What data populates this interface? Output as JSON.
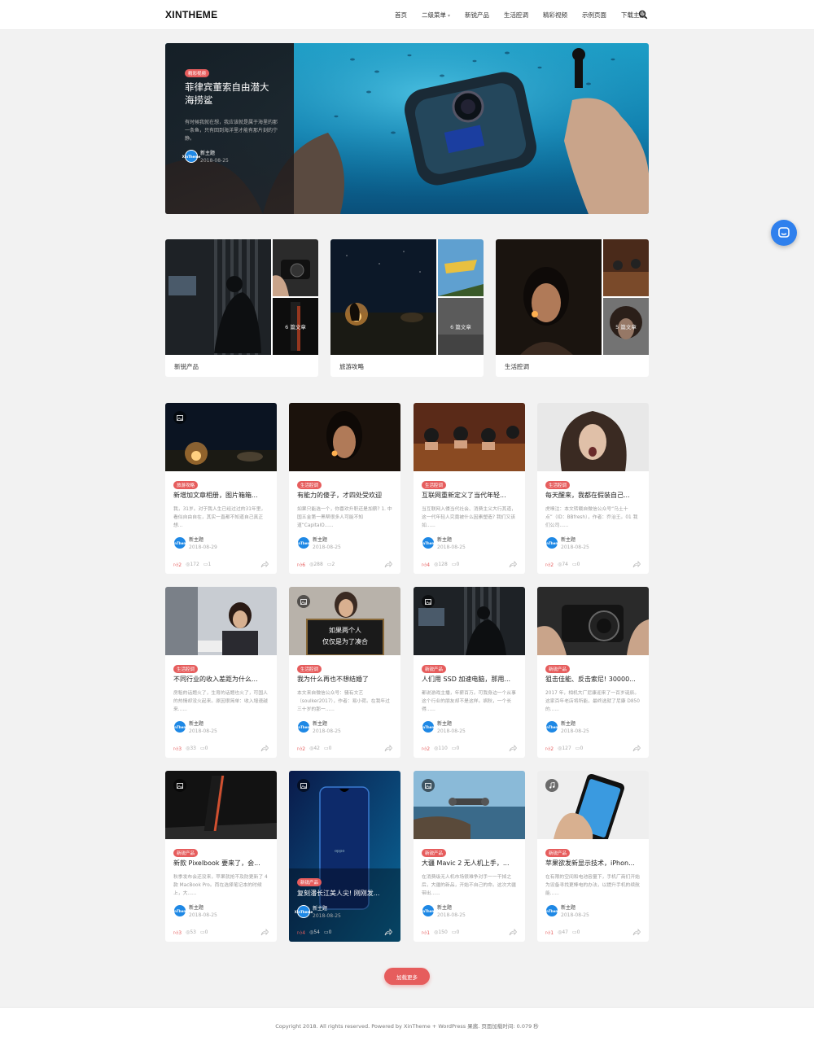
{
  "header": {
    "logo": "XINTHEME",
    "nav": [
      "首页",
      "二级菜单",
      "新锐产品",
      "生活腔调",
      "精彩视频",
      "示例页面",
      "下载主题"
    ]
  },
  "hero": {
    "tag": "精彩视频",
    "title": "菲律宾董索自由潜大海捞鲨",
    "desc": "有时候我就在想，我应该就是属于海里的那一条鱼，只有回到海洋里才能有那片刻的宁静。",
    "author": "新主题",
    "date": "2018-08-25"
  },
  "categories": [
    {
      "label": "新锐产品",
      "count": "6 篇文章"
    },
    {
      "label": "旅游攻略",
      "count": "6 篇文章"
    },
    {
      "label": "生活腔调",
      "count": "5 篇文章"
    }
  ],
  "cards": [
    {
      "tag": "旅游攻略",
      "title": "新增加文章相册，图片箱箱...",
      "excerpt": "我，31岁。对于我人生已经过过的31年里，看似自由自在，其实一直都不知道自己真正想...",
      "author": "新主题",
      "date": "2018-08-29",
      "likes": "2",
      "views": "172",
      "comments": "1"
    },
    {
      "tag": "生活腔调",
      "title": "有能力的傻子，才四处受欢迎",
      "excerpt": "如果只能选一个，你喜欢升职还是加薪? 1. 中国五金第一黑帮很多人可能不知道“CapitalO......",
      "author": "新主题",
      "date": "2018-08-25",
      "likes": "6",
      "views": "288",
      "comments": "2"
    },
    {
      "tag": "生活腔调",
      "title": "互联网重新定义了当代年轻...",
      "excerpt": "当互联网入侵当代社会、消费主义大行其道，这一代年轻人究竟被什么因素塑造? 我们又该如......",
      "author": "新主题",
      "date": "2018-08-25",
      "likes": "4",
      "views": "128",
      "comments": "0"
    },
    {
      "tag": "生活腔调",
      "title": "每天醒来，我都在假装自己...",
      "excerpt": "虎嗅注：本文转载自微信公众号“乌土十点”（ID：BBfresh），作者：乔治王。01 我们公司......",
      "author": "新主题",
      "date": "2018-08-25",
      "likes": "2",
      "views": "74",
      "comments": "0"
    },
    {
      "tag": "生活腔调",
      "title": "不同行业的收入差距为什么...",
      "excerpt": "房租的话题火了，生育的话题也火了，可国人的热情却没火起来。原因很简单：收入增速越来......",
      "author": "新主题",
      "date": "2018-08-25",
      "likes": "3",
      "views": "33",
      "comments": "0"
    },
    {
      "tag": "生活腔调",
      "title": "我为什么再也不想结婚了",
      "excerpt": "本文来自微信公众号：骚有文艺（soulker2017），作者：易小荷。在我年过三十岁的那一......",
      "author": "新主题",
      "date": "2018-08-25",
      "likes": "2",
      "views": "42",
      "comments": "0"
    },
    {
      "tag": "新锐产品",
      "title": "人们用 SSD 加速电脑，那用...",
      "excerpt": "都说游戏主播，年薪百万。可我身边一个从事这个行业的朋友却不是这样。飒秋，一个长得......",
      "author": "新主题",
      "date": "2018-08-25",
      "likes": "2",
      "views": "110",
      "comments": "0"
    },
    {
      "tag": "新锐产品",
      "title": "狙击佳能、反击索尼! 30000...",
      "excerpt": "2017 年，相机大厂尼康迎来了一百岁诞辰。这家百年老店将所能，最终选就了尼康 D850 的......",
      "author": "新主题",
      "date": "2018-08-25",
      "likes": "2",
      "views": "127",
      "comments": "0"
    },
    {
      "tag": "新锐产品",
      "title": "新款 Pixelbook 要来了，会...",
      "excerpt": "秋季发布会还没来，苹果就抢不及防更新了 4 款 MacBook Pro。而在选择笔记本的时候上，大......",
      "author": "新主题",
      "date": "2018-08-25",
      "likes": "3",
      "views": "53",
      "comments": "0"
    },
    {
      "tag": "新锐产品",
      "title": "复刻潘长江美人尖! 刚刚发...",
      "excerpt": "",
      "author": "新主题",
      "date": "2018-08-25",
      "likes": "4",
      "views": "54",
      "comments": "0"
    },
    {
      "tag": "新锐产品",
      "title": "大疆 Mavic 2 无人机上手，...",
      "excerpt": "在消费级无人机市场很难争对手一一干掉之后，大疆的新品，开始不自己的命。这次大疆带出......",
      "author": "新主题",
      "date": "2018-08-25",
      "likes": "1",
      "views": "150",
      "comments": "0"
    },
    {
      "tag": "新锐产品",
      "title": "苹果欲发新显示技术，iPhon...",
      "excerpt": "在有限的空间和电池容量下，手机厂商们开始为设备寻找更棒电的办法，以提升手机的续航能......",
      "author": "新主题",
      "date": "2018-08-25",
      "likes": "1",
      "views": "47",
      "comments": "0"
    }
  ],
  "load_more": "加载更多",
  "footer": "Copyright 2018. All rights reserved.  Powered by  XinTheme + WordPress 果酱. 页面加载时间: 0.079 秒",
  "avatar_text": "XinTheme",
  "colors": {
    "accent": "#e65d5d",
    "brand_blue": "#1e88e5",
    "chat": "#2f80ed"
  }
}
